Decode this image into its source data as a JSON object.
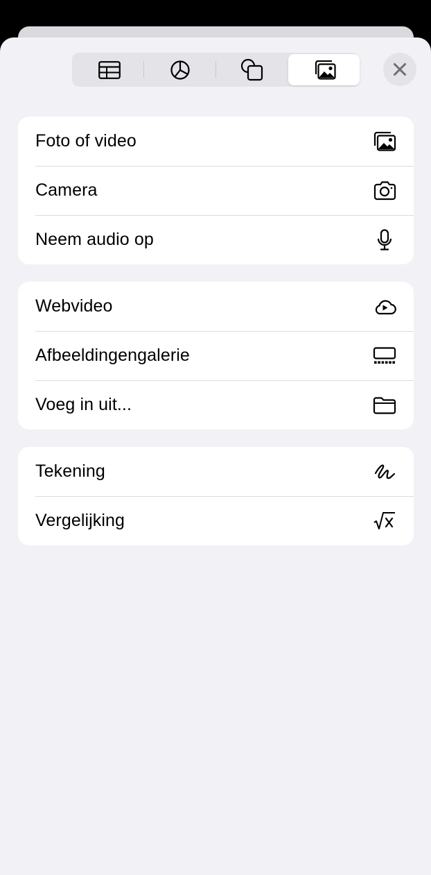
{
  "tabs": [
    {
      "name": "table",
      "icon": "table-icon",
      "active": false
    },
    {
      "name": "chart",
      "icon": "pie-chart-icon",
      "active": false
    },
    {
      "name": "shapes",
      "icon": "shapes-icon",
      "active": false
    },
    {
      "name": "media",
      "icon": "photo-stack-icon",
      "active": true
    }
  ],
  "groups": [
    {
      "items": [
        {
          "label": "Foto of video",
          "icon": "photo-stack-icon"
        },
        {
          "label": "Camera",
          "icon": "camera-icon"
        },
        {
          "label": "Neem audio op",
          "icon": "microphone-icon"
        }
      ]
    },
    {
      "items": [
        {
          "label": "Webvideo",
          "icon": "cloud-play-icon"
        },
        {
          "label": "Afbeeldingengalerie",
          "icon": "gallery-icon"
        },
        {
          "label": "Voeg in uit...",
          "icon": "folder-icon"
        }
      ]
    },
    {
      "items": [
        {
          "label": "Tekening",
          "icon": "scribble-icon"
        },
        {
          "label": "Vergelijking",
          "icon": "square-root-icon"
        }
      ]
    }
  ],
  "close_icon": "close-icon"
}
